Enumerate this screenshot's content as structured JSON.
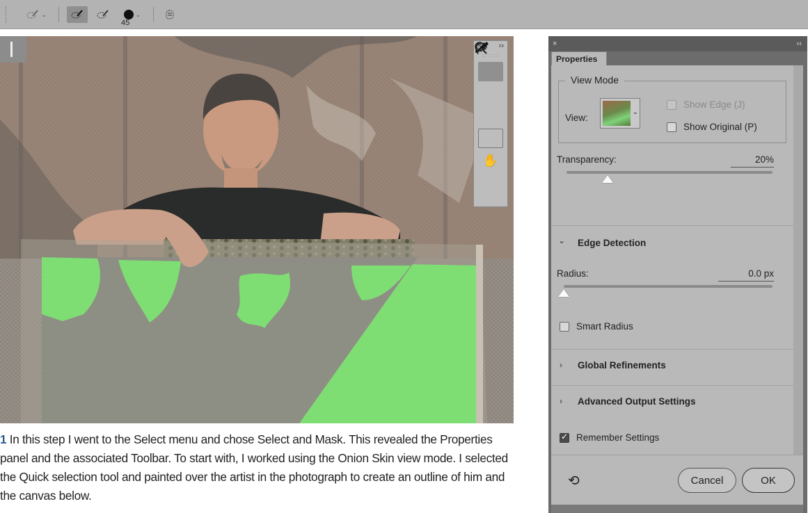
{
  "options_bar": {
    "brush_size": "45"
  },
  "step": {
    "number": "1",
    "text": " In this step I went to the Select menu and chose Select and Mask. This revealed the Properties panel and the associated Toolbar. To start with, I worked using the Onion Skin view mode. I selected the Quick selection tool and painted over the artist in the photograph to create an outline of him and the canvas below."
  },
  "toolbar": {
    "close": "×",
    "collapse": "››",
    "tools": [
      "quick-selection",
      "refine-edge-brush",
      "brush",
      "lasso",
      "hand",
      "zoom"
    ]
  },
  "properties": {
    "close": "×",
    "collapse": "‹‹",
    "tab": "Properties",
    "view_mode": {
      "title": "View Mode",
      "view_label": "View:",
      "show_edge": "Show Edge (J)",
      "show_original": "Show Original (P)"
    },
    "transparency": {
      "label": "Transparency:",
      "value": "20%",
      "level_pct": 20
    },
    "edge_detection": {
      "title": "Edge Detection",
      "radius_label": "Radius:",
      "radius_value": "0.0 px",
      "radius_level": 0,
      "smart_radius": "Smart Radius"
    },
    "global_refinements": "Global Refinements",
    "advanced_output": "Advanced Output Settings",
    "remember_settings": "Remember Settings",
    "cancel": "Cancel",
    "ok": "OK"
  }
}
